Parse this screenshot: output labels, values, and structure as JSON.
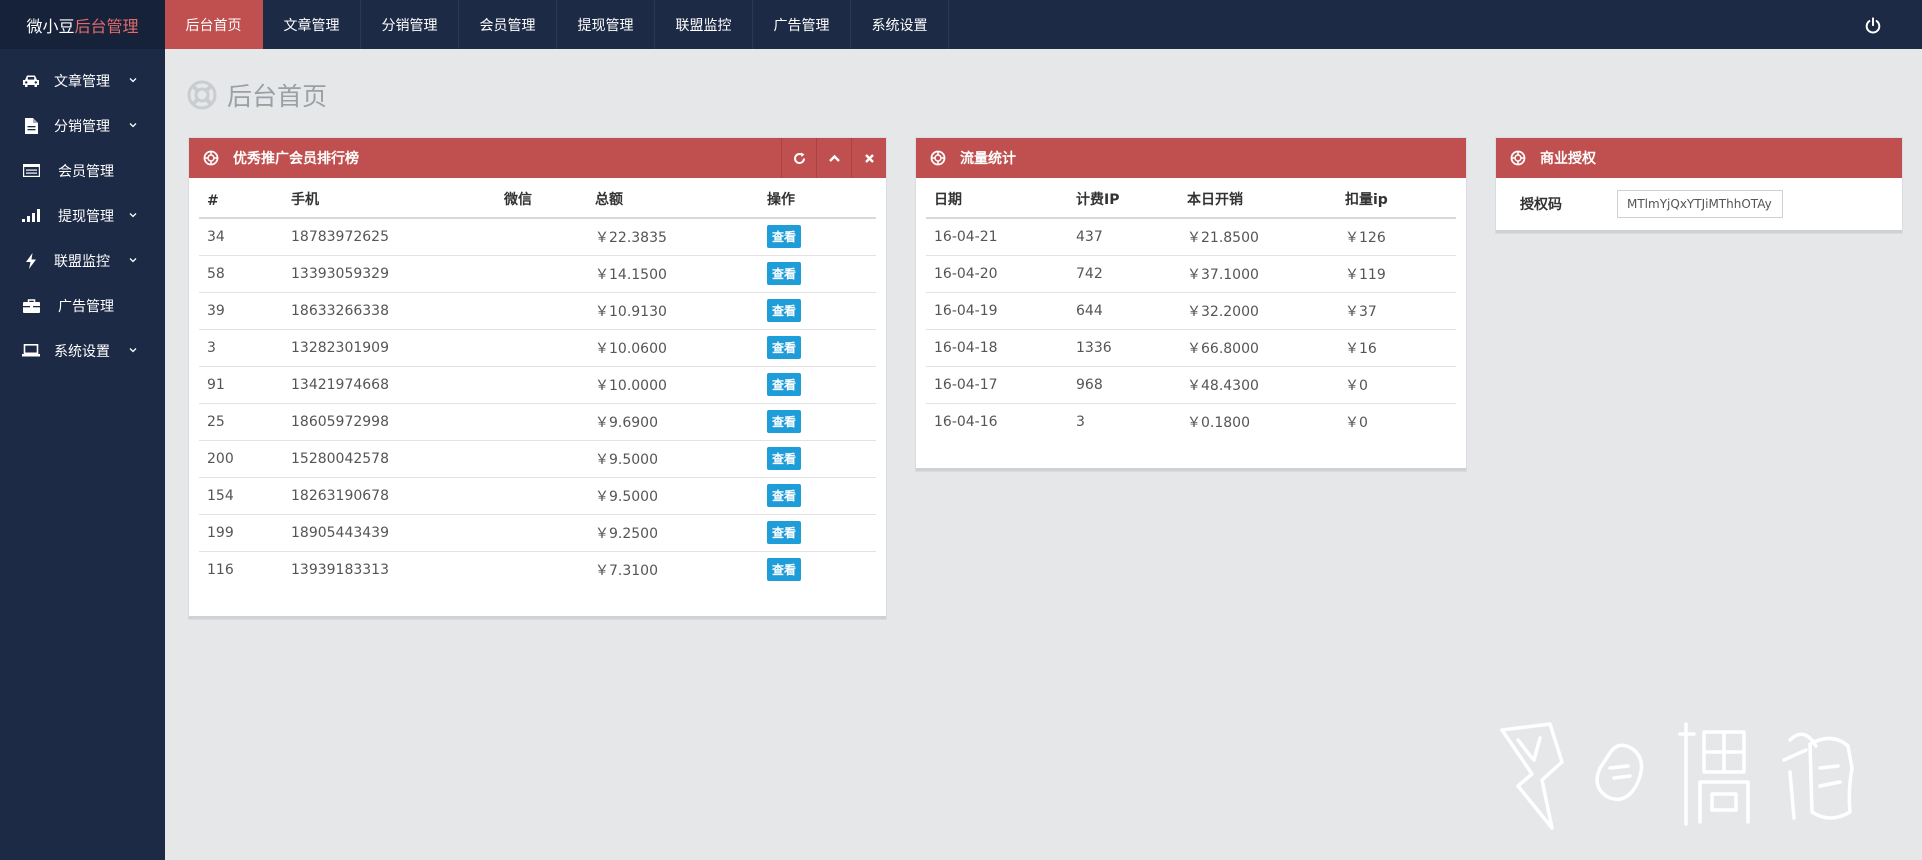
{
  "brand": {
    "prefix": "微小豆",
    "accent": "后台管理"
  },
  "topnav": [
    {
      "label": "后台首页",
      "active": true
    },
    {
      "label": "文章管理"
    },
    {
      "label": "分销管理"
    },
    {
      "label": "会员管理"
    },
    {
      "label": "提现管理"
    },
    {
      "label": "联盟监控"
    },
    {
      "label": "广告管理"
    },
    {
      "label": "系统设置"
    }
  ],
  "sidebar": {
    "items": [
      {
        "label": "文章管理",
        "icon": "car-icon",
        "has_submenu": true
      },
      {
        "label": "分销管理",
        "icon": "file-icon",
        "has_submenu": true
      },
      {
        "label": "会员管理",
        "icon": "list-icon",
        "has_submenu": false
      },
      {
        "label": "提现管理",
        "icon": "signal-icon",
        "has_submenu": true
      },
      {
        "label": "联盟监控",
        "icon": "bolt-icon",
        "has_submenu": true
      },
      {
        "label": "广告管理",
        "icon": "briefcase-icon",
        "has_submenu": false
      },
      {
        "label": "系统设置",
        "icon": "laptop-icon",
        "has_submenu": true
      }
    ]
  },
  "page": {
    "title": "后台首页"
  },
  "ranking_panel": {
    "title": "优秀推广会员排行榜",
    "columns": [
      "#",
      "手机",
      "微信",
      "总额",
      "操作"
    ],
    "view_label": "查看",
    "rows": [
      {
        "id": "34",
        "phone": "18783972625",
        "wechat": "",
        "total": "￥22.3835"
      },
      {
        "id": "58",
        "phone": "13393059329",
        "wechat": "",
        "total": "￥14.1500"
      },
      {
        "id": "39",
        "phone": "18633266338",
        "wechat": "",
        "total": "￥10.9130"
      },
      {
        "id": "3",
        "phone": "13282301909",
        "wechat": "",
        "total": "￥10.0600"
      },
      {
        "id": "91",
        "phone": "13421974668",
        "wechat": "",
        "total": "￥10.0000"
      },
      {
        "id": "25",
        "phone": "18605972998",
        "wechat": "",
        "total": "￥9.6900"
      },
      {
        "id": "200",
        "phone": "15280042578",
        "wechat": "",
        "total": "￥9.5000"
      },
      {
        "id": "154",
        "phone": "18263190678",
        "wechat": "",
        "total": "￥9.5000"
      },
      {
        "id": "199",
        "phone": "18905443439",
        "wechat": "",
        "total": "￥9.2500"
      },
      {
        "id": "116",
        "phone": "13939183313",
        "wechat": "",
        "total": "￥7.3100"
      }
    ]
  },
  "traffic_panel": {
    "title": "流量统计",
    "columns": [
      "日期",
      "计费IP",
      "本日开销",
      "扣量ip"
    ],
    "rows": [
      {
        "date": "16-04-21",
        "ip": "437",
        "cost": "￥21.8500",
        "deduct": "￥126"
      },
      {
        "date": "16-04-20",
        "ip": "742",
        "cost": "￥37.1000",
        "deduct": "￥119"
      },
      {
        "date": "16-04-19",
        "ip": "644",
        "cost": "￥32.2000",
        "deduct": "￥37"
      },
      {
        "date": "16-04-18",
        "ip": "1336",
        "cost": "￥66.8000",
        "deduct": "￥16"
      },
      {
        "date": "16-04-17",
        "ip": "968",
        "cost": "￥48.4300",
        "deduct": "￥0"
      },
      {
        "date": "16-04-16",
        "ip": "3",
        "cost": "￥0.1800",
        "deduct": "￥0"
      }
    ]
  },
  "license_panel": {
    "title": "商业授权",
    "label": "授权码",
    "value": "MTlmYjQxYTJiMThhOTAy"
  },
  "colors": {
    "nav_bg": "#1c2a45",
    "accent_red": "#c0504f",
    "button_blue": "#1f9dd8",
    "content_bg": "#e6e7e9"
  }
}
